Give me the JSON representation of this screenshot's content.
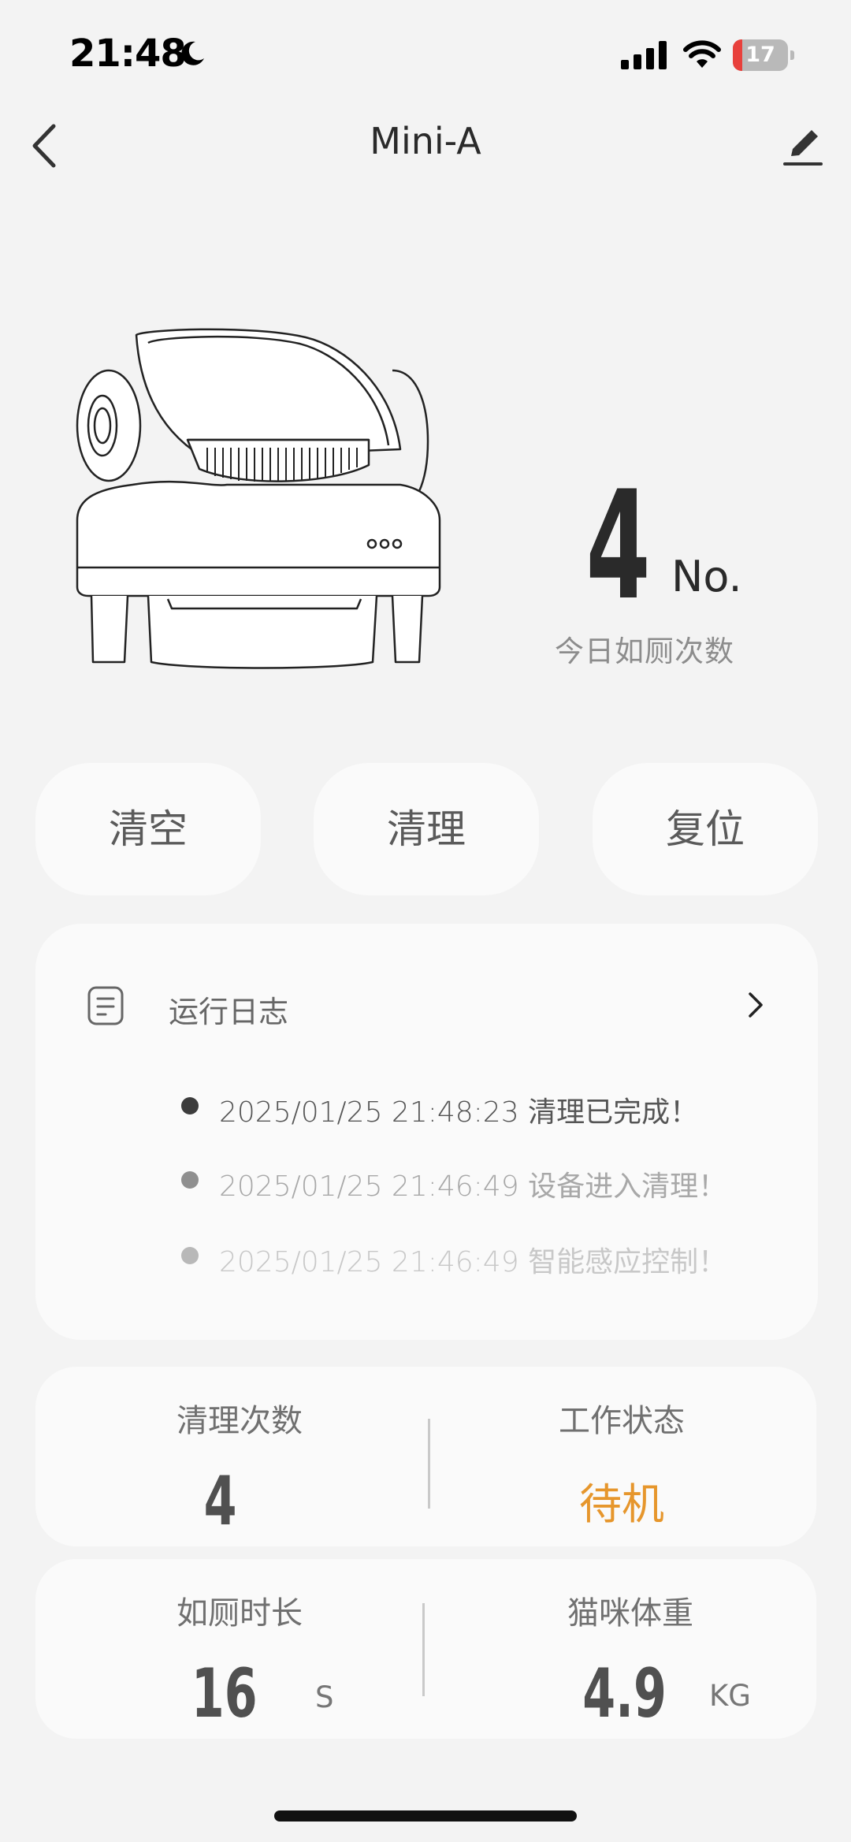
{
  "status_bar": {
    "time": "21:48",
    "battery": "17"
  },
  "nav": {
    "title": "Mini-A"
  },
  "today": {
    "count": "4",
    "unit": "No.",
    "label": "今日如厕次数"
  },
  "actions": {
    "empty": "清空",
    "clean": "清理",
    "reset": "复位"
  },
  "log": {
    "title": "运行日志",
    "entries": [
      {
        "text": "2025/01/25 21:48:23 清理已完成！",
        "color": "#4a4a4a"
      },
      {
        "text": "2025/01/25 21:46:49 设备进入清理！",
        "color": "#a0a0a0"
      },
      {
        "text": "2025/01/25 21:46:49 智能感应控制！",
        "color": "#c4c4c4"
      }
    ]
  },
  "stats": {
    "clean_count": {
      "label": "清理次数",
      "value": "4"
    },
    "work_status": {
      "label": "工作状态",
      "value": "待机",
      "color": "#e6962c"
    },
    "toilet_duration": {
      "label": "如厕时长",
      "value": "16",
      "unit": "S"
    },
    "cat_weight": {
      "label": "猫咪体重",
      "value": "4.9",
      "unit": "KG"
    }
  }
}
